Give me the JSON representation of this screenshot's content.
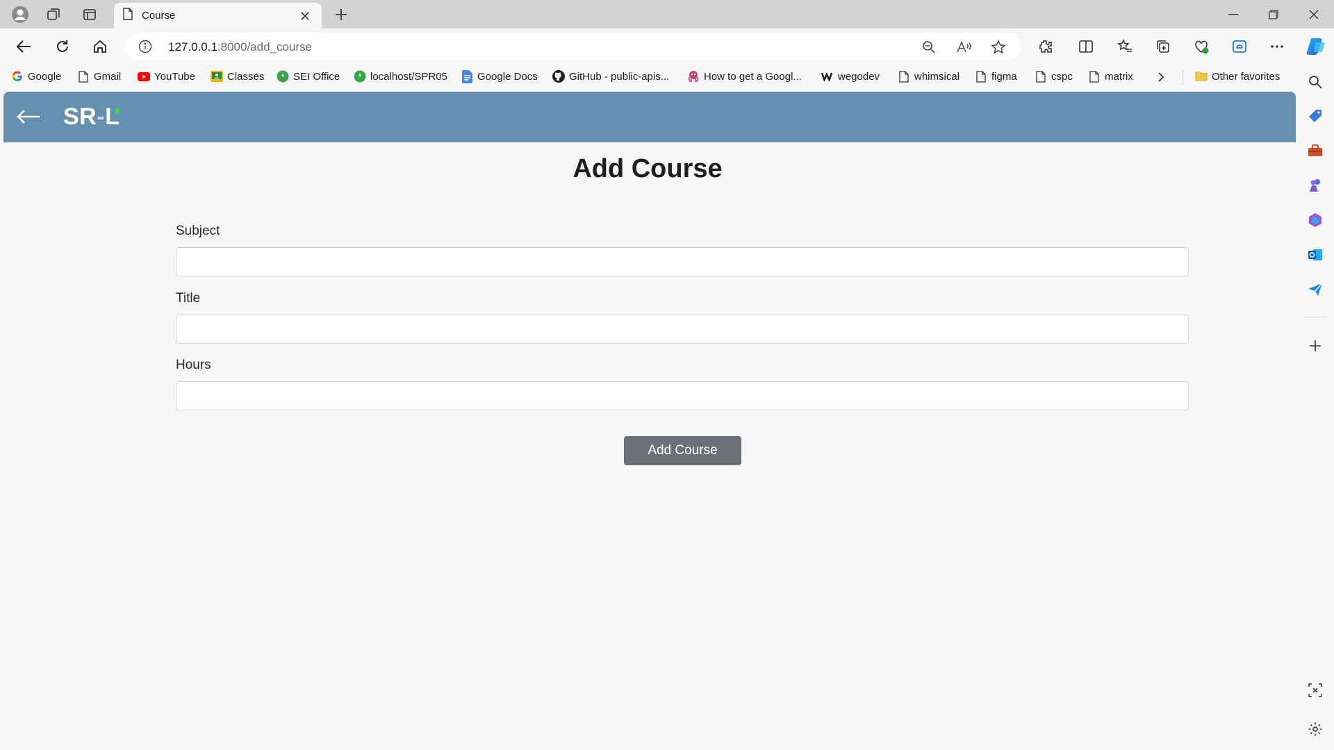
{
  "browser": {
    "tab_title": "Course",
    "url_host": "127.0.0.1",
    "url_path": ":8000/add_course",
    "bookmarks": [
      {
        "label": "Google",
        "icon": "google-icon"
      },
      {
        "label": "Gmail",
        "icon": "page-icon"
      },
      {
        "label": "YouTube",
        "icon": "youtube-icon"
      },
      {
        "label": "Classes",
        "icon": "classroom-icon"
      },
      {
        "label": "SEI Office",
        "icon": "green-circle-icon"
      },
      {
        "label": "localhost/SPR05",
        "icon": "green-circle-icon"
      },
      {
        "label": "Google Docs",
        "icon": "docs-icon"
      },
      {
        "label": "GitHub - public-apis...",
        "icon": "github-icon"
      },
      {
        "label": "How to get a Googl...",
        "icon": "octopus-icon"
      },
      {
        "label": "wegodev",
        "icon": "w-icon"
      },
      {
        "label": "whimsical",
        "icon": "page-icon"
      },
      {
        "label": "figma",
        "icon": "page-icon"
      },
      {
        "label": "cspc",
        "icon": "page-icon"
      },
      {
        "label": "matrix",
        "icon": "page-icon"
      }
    ],
    "other_favorites": "Other favorites"
  },
  "app": {
    "logo_sr": "SR",
    "logo_dash": "-",
    "logo_l": "L"
  },
  "form": {
    "title": "Add Course",
    "subject_label": "Subject",
    "title_label": "Title",
    "hours_label": "Hours",
    "subject_value": "",
    "title_value": "",
    "hours_value": "",
    "submit_label": "Add Course"
  },
  "colors": {
    "header": "#6690b0",
    "button": "#6b7177",
    "page_bg": "#f7f7f9"
  }
}
